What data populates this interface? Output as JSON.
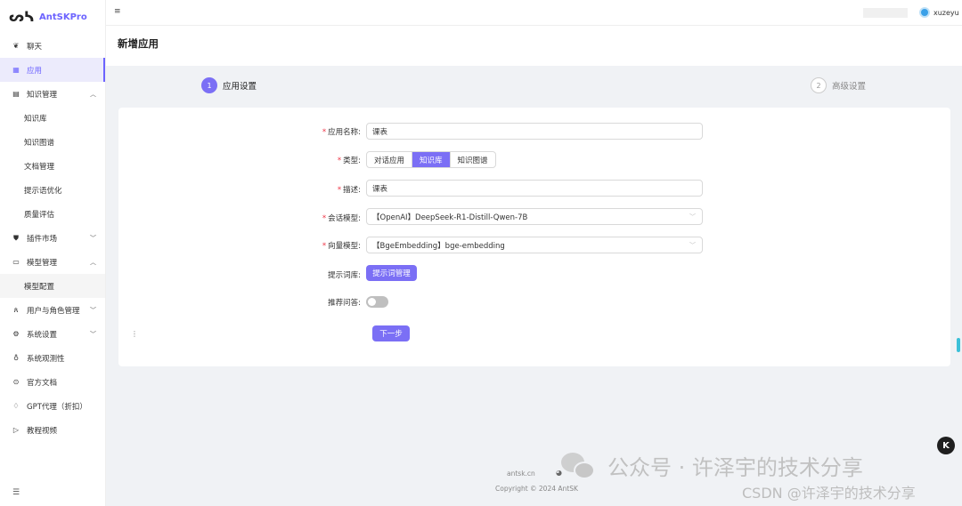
{
  "app": {
    "logo_mark": "ᔕᓴ",
    "name": "AntSKPro"
  },
  "sidebar": {
    "items": [
      {
        "label": "聊天",
        "icon": "chat-icon"
      },
      {
        "label": "应用",
        "icon": "app-icon",
        "active": true
      },
      {
        "label": "知识管理",
        "icon": "knowledge-icon",
        "expanded": true
      },
      {
        "label": "知识库",
        "sub": true
      },
      {
        "label": "知识图谱",
        "sub": true
      },
      {
        "label": "文档管理",
        "sub": true
      },
      {
        "label": "提示语优化",
        "sub": true
      },
      {
        "label": "质量评估",
        "sub": true
      },
      {
        "label": "插件市场",
        "icon": "plugin-icon",
        "expanded": false
      },
      {
        "label": "模型管理",
        "icon": "model-icon",
        "expanded": true
      },
      {
        "label": "模型配置",
        "sub": true
      },
      {
        "label": "用户与角色管理",
        "icon": "users-icon",
        "expanded": false
      },
      {
        "label": "系统设置",
        "icon": "settings-icon",
        "expanded": false
      },
      {
        "label": "系统观测性",
        "icon": "observe-icon"
      },
      {
        "label": "官方文档",
        "icon": "docs-icon"
      },
      {
        "label": "GPT代理（折扣）",
        "icon": "proxy-icon"
      },
      {
        "label": "教程视频",
        "icon": "video-icon"
      }
    ]
  },
  "header": {
    "username": "xuzeyu"
  },
  "page": {
    "title": "新增应用"
  },
  "steps": [
    {
      "num": "1",
      "label": "应用设置"
    },
    {
      "num": "2",
      "label": "高级设置"
    }
  ],
  "form": {
    "name_label": "应用名称:",
    "name_value": "课表",
    "type_label": "类型:",
    "type_options": [
      "对话应用",
      "知识库",
      "知识图谱"
    ],
    "type_selected": "知识库",
    "desc_label": "描述:",
    "desc_value": "课表",
    "chat_model_label": "会话模型:",
    "chat_model_value": "【OpenAI】DeepSeek-R1-Distill-Qwen-7B",
    "embed_model_label": "向量模型:",
    "embed_model_value": "【BgeEmbedding】bge-embedding",
    "prompt_label": "提示词库:",
    "prompt_button": "提示词管理",
    "recommend_label": "推荐问答:",
    "next_button": "下一步"
  },
  "footer": {
    "link": "antsk.cn",
    "copyright": "Copyright © 2024 AntSK"
  },
  "watermark": {
    "text": "公众号 · 许泽宇的技术分享",
    "csdn": "CSDN @许泽宇的技术分享"
  },
  "colors": {
    "accent": "#7b6ff5",
    "required": "#e34"
  }
}
